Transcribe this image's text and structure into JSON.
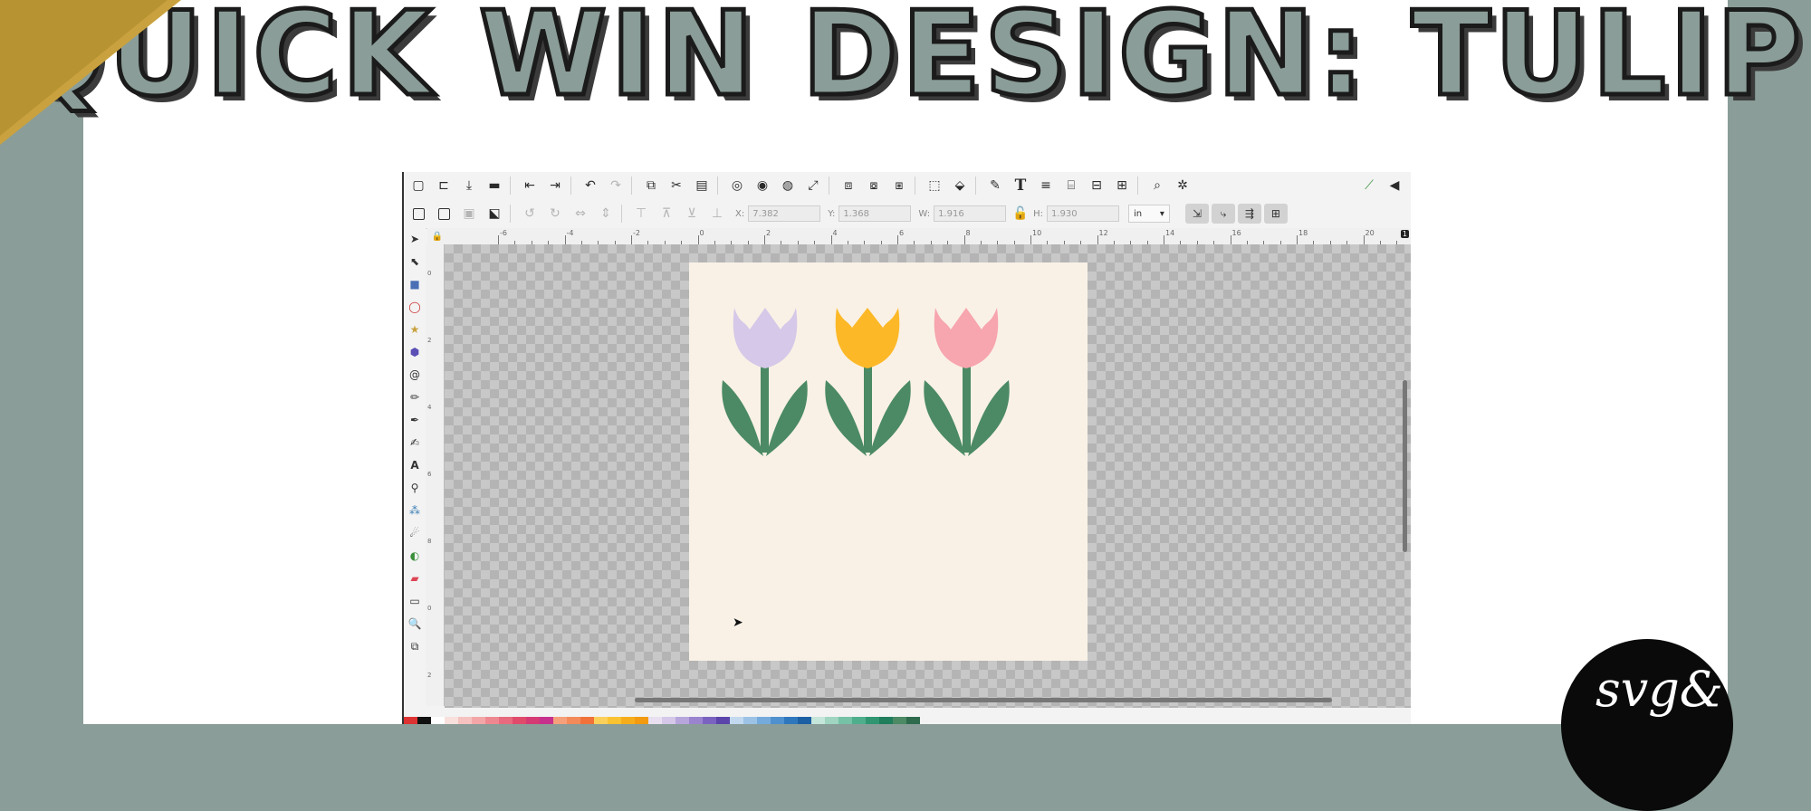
{
  "title": "QUICK WIN DESIGN: TULIP",
  "colors": {
    "background": "#8a9d98",
    "panel": "#ffffff",
    "accent_gold": "#c9a23f",
    "page": "#f9f1e6",
    "petal_lavender": "#d5c8e8",
    "petal_yellow": "#fcb827",
    "petal_pink": "#f7a5ae",
    "leaf_green": "#4b8a64"
  },
  "inkscape": {
    "command_icons": [
      "new-document-icon",
      "open-icon",
      "save-icon",
      "print-icon",
      "import-icon",
      "export-icon",
      "undo-icon",
      "redo-icon",
      "copy-icon",
      "cut-icon",
      "paste-icon",
      "zoom-selection-icon",
      "zoom-drawing-icon",
      "zoom-page-icon",
      "zoom-fit-icon",
      "duplicate-icon",
      "clone-icon",
      "unlink-clone-icon",
      "group-icon",
      "ungroup-icon",
      "fill-stroke-icon",
      "text-icon",
      "layers-icon",
      "xml-editor-icon",
      "align-icon",
      "distribute-icon",
      "find-icon",
      "preferences-icon"
    ],
    "fields": {
      "x_label": "X:",
      "x_value": "7.382",
      "y_label": "Y:",
      "y_value": "1.368",
      "w_label": "W:",
      "w_value": "1.916",
      "h_label": "H:",
      "h_value": "1.930",
      "unit": "in"
    },
    "ruler_labels": [
      "-6",
      "-4",
      "-2",
      "0",
      "2",
      "4",
      "6",
      "8",
      "10",
      "12",
      "14",
      "16",
      "18",
      "20"
    ],
    "vruler_labels": [
      "0",
      "2",
      "4",
      "6",
      "8",
      "0",
      "2"
    ],
    "corner_badge": "1"
  },
  "logo_text": "svg&"
}
